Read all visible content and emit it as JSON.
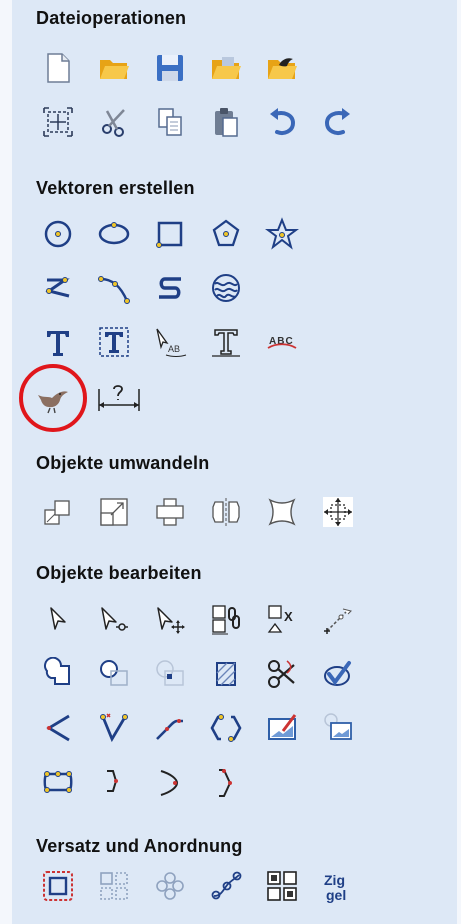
{
  "sections": {
    "file_ops": "Dateioperationen",
    "create_vectors": "Vektoren erstellen",
    "transform_objects": "Objekte umwandeln",
    "edit_objects": "Objekte  bearbeiten",
    "offset_arrange": "Versatz und Anordnung"
  },
  "icons": {
    "text_on_curve_label": "AB",
    "text_arc_label": "ABC",
    "edit_mark_label": "X",
    "split_label_top": "Zig",
    "split_label_bottom": "gel"
  },
  "colors": {
    "panel_bg": "#dde8f6",
    "icon_blue": "#1f3f86",
    "highlight_ring": "#e0161b",
    "folder_yellow": "#f2b924"
  }
}
